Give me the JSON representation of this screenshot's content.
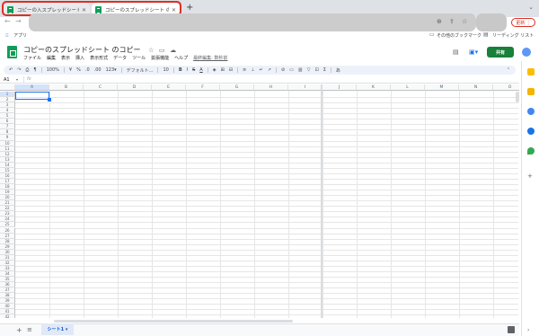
{
  "browser": {
    "tabs": [
      {
        "title": "コピーの入スプレッドシート – Goo",
        "close": "✕",
        "active": false
      },
      {
        "title": "コピーのスプレッドシート のコピ",
        "close": "✕",
        "active": true
      }
    ],
    "new_tab": "+",
    "tab_menu": "⌄",
    "back": "←",
    "forward": "→",
    "reload": "⟳",
    "update_label": "更新 ⋮",
    "bookmarks": {
      "apps": "アプリ",
      "other": "その他のブックマーク",
      "reading": "リーディング リスト"
    }
  },
  "sheets": {
    "title": "コピーのスプレッドシート のコピー",
    "menu": [
      "ファイル",
      "編集",
      "表示",
      "挿入",
      "表示形式",
      "データ",
      "ツール",
      "拡張機能",
      "ヘルプ"
    ],
    "last_edit": "最終編集: 数秒前",
    "share_label": "共有",
    "toolbar": {
      "zoom": "100%",
      "currency": "¥",
      "percent": "%",
      "dec_less": ".0",
      "dec_more": ".00",
      "format_more": "123▾",
      "font": "デフォルト...",
      "font_size": "10"
    },
    "name_box": "A1",
    "columns": [
      "A",
      "B",
      "C",
      "D",
      "E",
      "F",
      "G",
      "H",
      "I",
      "J",
      "K",
      "L",
      "M",
      "N",
      "O"
    ],
    "rows": [
      "1",
      "2",
      "3",
      "4",
      "5",
      "6",
      "7",
      "8",
      "9",
      "10",
      "11",
      "12",
      "13",
      "14",
      "15",
      "16",
      "17",
      "18",
      "19",
      "20",
      "21",
      "22",
      "23",
      "24",
      "25",
      "26",
      "27",
      "28",
      "29",
      "30",
      "31",
      "32",
      "33",
      "34",
      "35",
      "36",
      "37",
      "38",
      "39",
      "40",
      "41",
      "42"
    ],
    "sheet_tab": "シート1 ▾",
    "add_sheet": "+",
    "all_sheets": "≡"
  },
  "colors": {
    "accent": "#1a73e8",
    "sheets_green": "#0f9d58",
    "share_green": "#188038",
    "outline_red": "#d93025"
  }
}
